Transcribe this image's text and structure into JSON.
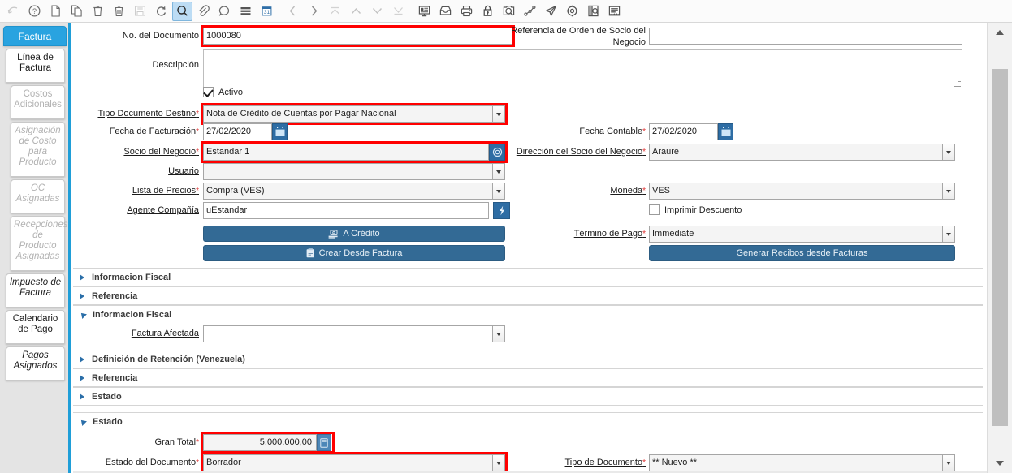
{
  "toolbar": {
    "icons": [
      {
        "name": "undo-icon",
        "active": false
      },
      {
        "name": "help-icon",
        "active": false
      },
      {
        "name": "new-record-icon",
        "active": false
      },
      {
        "name": "copy-record-icon",
        "active": false
      },
      {
        "name": "delete-icon",
        "active": false
      },
      {
        "name": "delete-selection-icon",
        "active": false
      },
      {
        "name": "save-icon",
        "active": false
      },
      {
        "name": "refresh-icon",
        "active": false
      },
      {
        "name": "find-icon",
        "active": true
      },
      {
        "name": "attachment-icon",
        "active": false
      },
      {
        "name": "chat-note-icon",
        "active": false
      },
      {
        "name": "grid-toggle-icon",
        "active": false
      },
      {
        "name": "calendar-icon",
        "active": false
      },
      {
        "name": "previous-record-icon",
        "active": false
      },
      {
        "name": "next-record-icon",
        "active": false
      },
      {
        "name": "first-record-icon",
        "active": false
      },
      {
        "name": "page-up-icon",
        "active": false
      },
      {
        "name": "page-down-icon",
        "active": false
      },
      {
        "name": "last-record-icon",
        "active": false
      },
      {
        "name": "zoom-across-icon",
        "active": false
      },
      {
        "name": "archive-icon",
        "active": false
      },
      {
        "name": "print-icon",
        "active": false
      },
      {
        "name": "lock-icon",
        "active": false
      },
      {
        "name": "print-preview-icon",
        "active": false
      },
      {
        "name": "workflow-icon",
        "active": false
      },
      {
        "name": "send-mail-icon",
        "active": false
      },
      {
        "name": "preferences-icon",
        "active": false
      },
      {
        "name": "report-icon",
        "active": false
      },
      {
        "name": "document-lines-icon",
        "active": false
      }
    ]
  },
  "sidebar": {
    "tabs": [
      {
        "label": "Factura",
        "state": "active"
      },
      {
        "label": "Línea de Factura",
        "state": "normal"
      },
      {
        "label": "Costos Adicionales",
        "state": "disabled"
      },
      {
        "label": "Asignación de Costo para Producto",
        "state": "disabled-italic"
      },
      {
        "label": "OC Asignadas",
        "state": "disabled-italic"
      },
      {
        "label": "Recepciones de Producto Asignadas",
        "state": "disabled-italic"
      },
      {
        "label": "Impuesto de Factura",
        "state": "italic"
      },
      {
        "label": "Calendario de Pago",
        "state": "normal"
      },
      {
        "label": "Pagos Asignados",
        "state": "italic"
      }
    ]
  },
  "form": {
    "document_no": {
      "label": "No. del Documento",
      "value": "1000080",
      "highlighted": true
    },
    "bp_order_reference": {
      "label": "Referencia de Orden de Socio del Negocio",
      "value": ""
    },
    "description": {
      "label": "Descripción",
      "value": ""
    },
    "active": {
      "label": "Activo",
      "checked": true
    },
    "target_doc_type": {
      "label": "Tipo Documento Destino",
      "required": true,
      "value": "Nota de Crédito de Cuentas por Pagar Nacional",
      "highlighted": true
    },
    "invoice_date": {
      "label": "Fecha de Facturación",
      "required": true,
      "value": "27/02/2020"
    },
    "accounting_date": {
      "label": "Fecha Contable",
      "required": true,
      "value": "27/02/2020"
    },
    "business_partner": {
      "label": "Socio del Negocio",
      "required": true,
      "value": "Estandar 1",
      "highlighted": true
    },
    "bp_address": {
      "label": "Dirección del Socio del Negocio",
      "required": true,
      "value": "Araure"
    },
    "user": {
      "label": "Usuario",
      "value": ""
    },
    "price_list": {
      "label": "Lista de Precios",
      "required": true,
      "value": "Compra (VES)"
    },
    "currency": {
      "label": "Moneda",
      "required": true,
      "value": "VES"
    },
    "company_agent": {
      "label": "Agente Compañía",
      "value": "uEstandar"
    },
    "print_discount": {
      "label": "Imprimir Descuento",
      "checked": false
    },
    "payment_rule_button": {
      "label": "A Crédito"
    },
    "create_from_invoice_button": {
      "label": "Crear Desde Factura"
    },
    "payment_term": {
      "label": "Término de Pago",
      "required": true,
      "value": "Immediate"
    },
    "generate_receipts_button": {
      "label": "Generar Recibos desde Facturas"
    },
    "affected_invoice": {
      "label": "Factura Afectada",
      "value": ""
    },
    "grand_total": {
      "label": "Gran Total",
      "required": true,
      "value": "5.000.000,00",
      "highlighted": true
    },
    "document_status": {
      "label": "Estado del Documento",
      "required": true,
      "value": "Borrador",
      "highlighted": true
    },
    "document_action": {
      "label": "Tipo de Documento",
      "required": true,
      "value": "** Nuevo **"
    }
  },
  "sections": [
    {
      "title": "Informacion Fiscal",
      "expanded": false
    },
    {
      "title": "Referencia",
      "expanded": false
    },
    {
      "title": "Informacion Fiscal",
      "expanded": true
    },
    {
      "title": "Definición de Retención (Venezuela)",
      "expanded": false
    },
    {
      "title": "Referencia",
      "expanded": false
    },
    {
      "title": "Estado",
      "expanded": false
    },
    {
      "title": "Estado",
      "expanded": true
    }
  ],
  "colors": {
    "accent_blue": "#29a3e0",
    "button_blue": "#336a95",
    "highlight_red": "#ff0000",
    "rail_background": "#e4e4e4"
  }
}
